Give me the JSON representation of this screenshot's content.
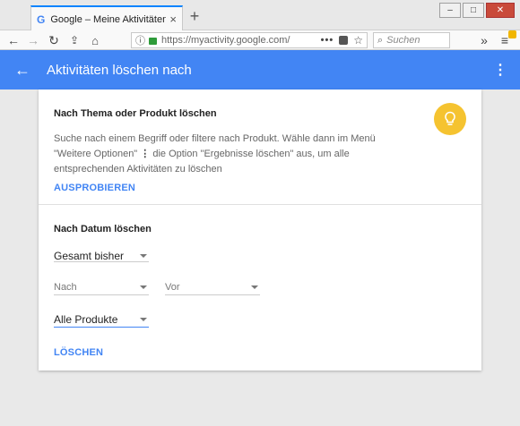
{
  "browser": {
    "tab_title": "Google – Meine Aktivitäten",
    "tab_favicon": "G",
    "tab_close": "×",
    "new_tab": "+",
    "url": "https://myactivity.google.com/",
    "url_more": "•••",
    "search_placeholder": "Suchen",
    "overflow": "»",
    "menu": "≡"
  },
  "appbar": {
    "back": "←",
    "title": "Aktivitäten löschen nach",
    "more": "⋮"
  },
  "topic_section": {
    "title": "Nach Thema oder Produkt löschen",
    "desc_part1": "Suche nach einem Begriff oder filtere nach Produkt. Wähle dann im Menü \"Weitere Optionen\"",
    "desc_icon": "⋮",
    "desc_part2": "die Option \"Ergebnisse löschen\" aus, um alle entsprechenden Aktivitäten zu löschen",
    "action": "AUSPROBIEREN"
  },
  "date_section": {
    "title": "Nach Datum löschen",
    "range_value": "Gesamt bisher",
    "after_placeholder": "Nach",
    "before_placeholder": "Vor",
    "product_value": "Alle Produkte",
    "action": "LÖSCHEN"
  },
  "colors": {
    "accent": "#4285f4",
    "bulb": "#f5c330"
  }
}
